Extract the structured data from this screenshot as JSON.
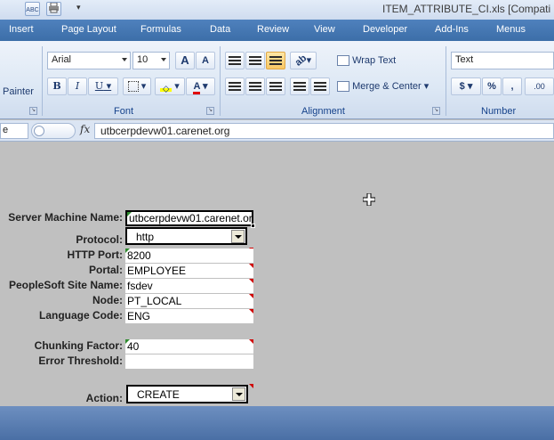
{
  "window": {
    "title": "ITEM_ATTRIBUTE_CI.xls  [Compati"
  },
  "qat": {
    "icons": [
      "spellcheck-icon",
      "print-icon"
    ],
    "spell_label": "ABC"
  },
  "tabs": [
    "Insert",
    "Page Layout",
    "Formulas",
    "Data",
    "Review",
    "View",
    "Developer",
    "Add-Ins",
    "Menus"
  ],
  "ribbon": {
    "clipboard": {
      "painter_label": "Painter"
    },
    "font": {
      "group_label": "Font",
      "font_name": "Arial",
      "font_size": "10",
      "grow_label": "A",
      "shrink_label": "A",
      "bold_label": "B",
      "italic_label": "I",
      "underline_label": "U",
      "color_label": "A"
    },
    "alignment": {
      "group_label": "Alignment",
      "wrap_text_label": "Wrap Text",
      "merge_center_label": "Merge & Center"
    },
    "number": {
      "group_label": "Number",
      "format_value": "Text",
      "currency_label": "$",
      "percent_label": "%",
      "comma_label": ",",
      "increase_decimal_label": ".00"
    }
  },
  "formula_bar": {
    "name_box": "e",
    "fx_label": "fx",
    "value": "utbcerpdevw01.carenet.org"
  },
  "form": {
    "server_machine_name": {
      "label": "Server Machine Name:",
      "value": "utbcerpdevw01.carenet.org"
    },
    "protocol": {
      "label": "Protocol:",
      "value": "http"
    },
    "http_port": {
      "label": "HTTP Port:",
      "value": "8200"
    },
    "portal": {
      "label": "Portal:",
      "value": "EMPLOYEE"
    },
    "site_name": {
      "label": "PeopleSoft Site Name:",
      "value": "fsdev"
    },
    "node": {
      "label": "Node:",
      "value": "PT_LOCAL"
    },
    "language_code": {
      "label": "Language Code:",
      "value": "ENG"
    },
    "chunking_factor": {
      "label": "Chunking Factor:",
      "value": "40"
    },
    "error_threshold": {
      "label": "Error Threshold:",
      "value": ""
    },
    "action": {
      "label": "Action:",
      "value": "CREATE"
    }
  },
  "colors": {
    "accent": "#4f81bd",
    "ribbon_text": "#15428b",
    "sheet_bg": "#c0c0c0",
    "comment_marker": "#d00000",
    "error_marker": "#2e8b2e"
  }
}
